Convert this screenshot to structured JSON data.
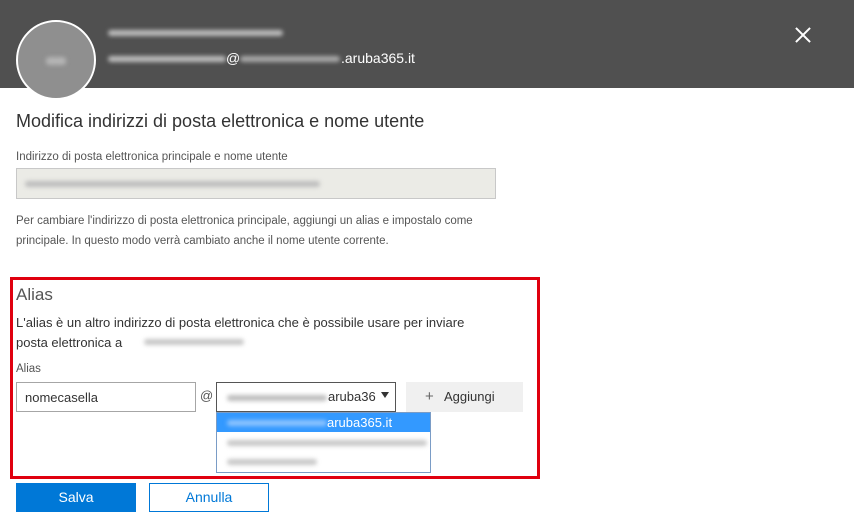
{
  "header": {
    "user_at": "@",
    "user_domain": ".aruba365.it",
    "close_icon": "close-icon"
  },
  "page": {
    "title": "Modifica indirizzi di posta elettronica e nome utente"
  },
  "primary": {
    "label": "Indirizzo di posta elettronica principale e nome utente",
    "help": "Per cambiare l'indirizzo di posta elettronica principale, aggiungi un alias e impostalo come principale. In questo modo verrà cambiato anche il nome utente corrente."
  },
  "alias": {
    "heading": "Alias",
    "description": "L'alias è un altro indirizzo di posta elettronica che è possibile usare per inviare posta elettronica a",
    "field_label": "Alias",
    "input_value": "nomecasella",
    "at_sign": "@",
    "domain_selected": "aruba365.it",
    "add_label": "Aggiungi",
    "dropdown_options": [
      {
        "label": "aruba365.it",
        "selected": true
      },
      {
        "label": "",
        "selected": false
      },
      {
        "label": "",
        "selected": false
      }
    ]
  },
  "footer": {
    "save_label": "Salva",
    "cancel_label": "Annulla"
  },
  "colors": {
    "header_bg": "#505050",
    "accent": "#0078d7",
    "highlight_border": "#e0000f",
    "dropdown_selected": "#3399ff"
  }
}
